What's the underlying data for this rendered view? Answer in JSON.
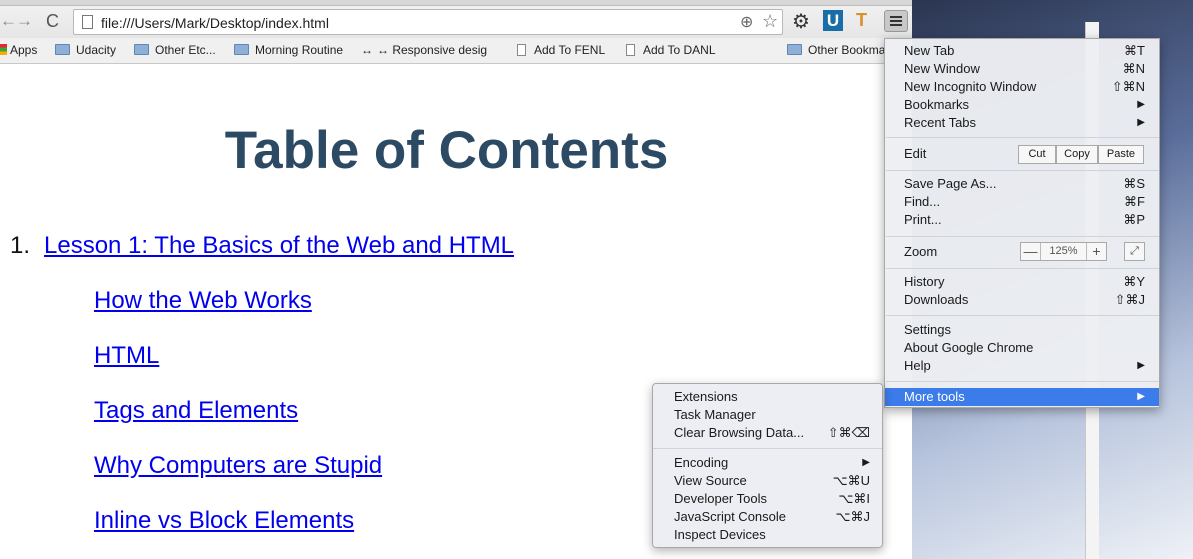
{
  "browser": {
    "url": "file:///Users/Mark/Desktop/index.html",
    "nav": {
      "back": "←",
      "forward": "→",
      "reload": "C"
    },
    "icons": {
      "zoom": "⊕",
      "star": "☆",
      "gear": "⚙",
      "ext_u": "U",
      "ext_t": "T"
    }
  },
  "bookmarks": [
    {
      "label": "Apps",
      "type": "apps"
    },
    {
      "label": "Udacity",
      "type": "folder"
    },
    {
      "label": "Other Etc...",
      "type": "folder"
    },
    {
      "label": "Morning Routine",
      "type": "folder"
    },
    {
      "label": "↔ Responsive desig",
      "type": "link"
    },
    {
      "label": "Add To FENL",
      "type": "file"
    },
    {
      "label": "Add To DANL",
      "type": "file"
    },
    {
      "label": "Other Bookma",
      "type": "folder"
    }
  ],
  "page": {
    "title": "Table of Contents",
    "number": "1.",
    "lesson": "Lesson 1: The Basics of the Web and HTML",
    "links": [
      "How the Web Works",
      "HTML",
      "Tags and Elements",
      "Why Computers are Stupid",
      "Inline vs Block Elements"
    ]
  },
  "menu": {
    "new_tab": {
      "label": "New Tab",
      "shortcut": "⌘T"
    },
    "new_window": {
      "label": "New Window",
      "shortcut": "⌘N"
    },
    "new_incognito": {
      "label": "New Incognito Window",
      "shortcut": "⇧⌘N"
    },
    "bookmarks": {
      "label": "Bookmarks",
      "arrow": "▶"
    },
    "recent_tabs": {
      "label": "Recent Tabs",
      "arrow": "▶"
    },
    "edit": {
      "label": "Edit",
      "cut": "Cut",
      "copy": "Copy",
      "paste": "Paste"
    },
    "save_page": {
      "label": "Save Page As...",
      "shortcut": "⌘S"
    },
    "find": {
      "label": "Find...",
      "shortcut": "⌘F"
    },
    "print": {
      "label": "Print...",
      "shortcut": "⌘P"
    },
    "zoom": {
      "label": "Zoom",
      "minus": "—",
      "value": "125%",
      "plus": "+",
      "fullscreen": "⤢"
    },
    "history": {
      "label": "History",
      "shortcut": "⌘Y"
    },
    "downloads": {
      "label": "Downloads",
      "shortcut": "⇧⌘J"
    },
    "settings": {
      "label": "Settings"
    },
    "about": {
      "label": "About Google Chrome"
    },
    "help": {
      "label": "Help",
      "arrow": "▶"
    },
    "more_tools": {
      "label": "More tools",
      "arrow": "▶"
    }
  },
  "submenu": {
    "extensions": {
      "label": "Extensions"
    },
    "task_manager": {
      "label": "Task Manager"
    },
    "clear_browsing": {
      "label": "Clear Browsing Data...",
      "shortcut": "⇧⌘⌫"
    },
    "encoding": {
      "label": "Encoding",
      "arrow": "▶"
    },
    "view_source": {
      "label": "View Source",
      "shortcut": "⌥⌘U"
    },
    "dev_tools": {
      "label": "Developer Tools",
      "shortcut": "⌥⌘I"
    },
    "js_console": {
      "label": "JavaScript Console",
      "shortcut": "⌥⌘J"
    },
    "inspect_devices": {
      "label": "Inspect Devices"
    }
  },
  "colors": {
    "accent": "#3b7bea",
    "title": "#2c4a63",
    "link": "#0000ee"
  }
}
